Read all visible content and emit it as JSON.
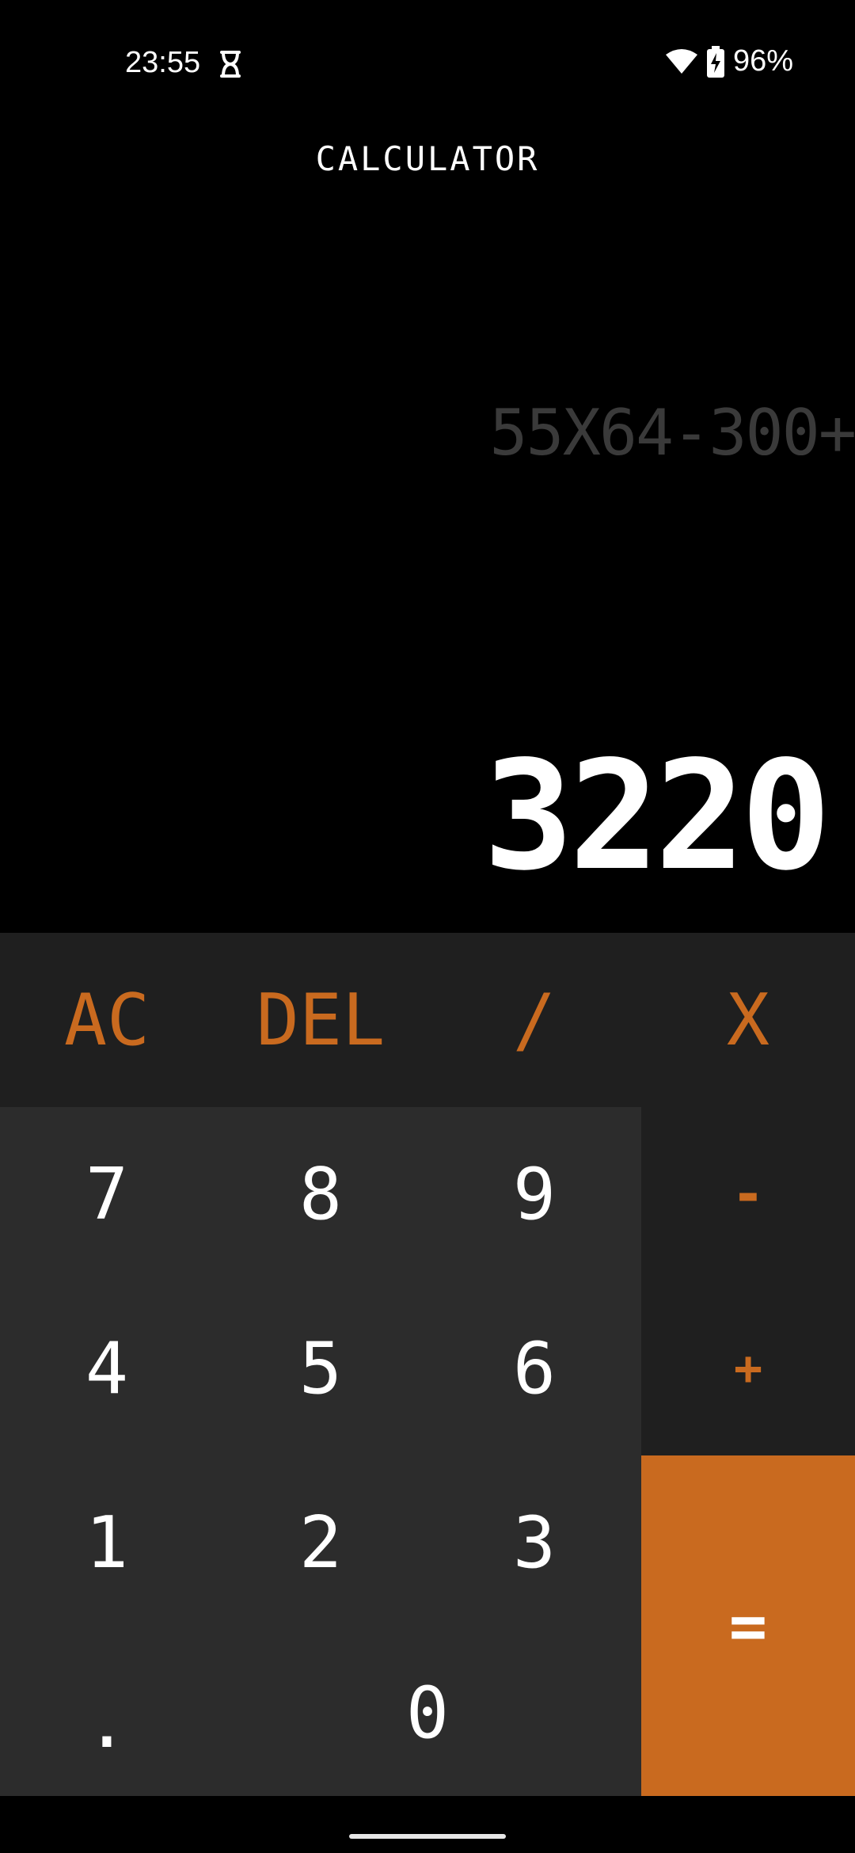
{
  "status_bar": {
    "time": "23:55",
    "battery": "96%",
    "icons": [
      "notification-icon",
      "wifi-icon",
      "battery-charging-icon"
    ]
  },
  "app": {
    "title": "CALCULATOR"
  },
  "display": {
    "expression": "55X64-300+",
    "result": "3220"
  },
  "keypad": {
    "row_top": [
      "AC",
      "DEL",
      "/",
      "X"
    ],
    "row1": [
      "7",
      "8",
      "9",
      "-"
    ],
    "row2": [
      "4",
      "5",
      "6",
      "+"
    ],
    "row3": [
      "1",
      "2",
      "3"
    ],
    "row4": [
      ".",
      "0"
    ],
    "equals": "="
  },
  "colors": {
    "accent": "#c96a1f",
    "keypad_bg": "#1f1f1f",
    "number_area_bg": "#2c2c2c",
    "expression_text": "#3a3a3a"
  }
}
